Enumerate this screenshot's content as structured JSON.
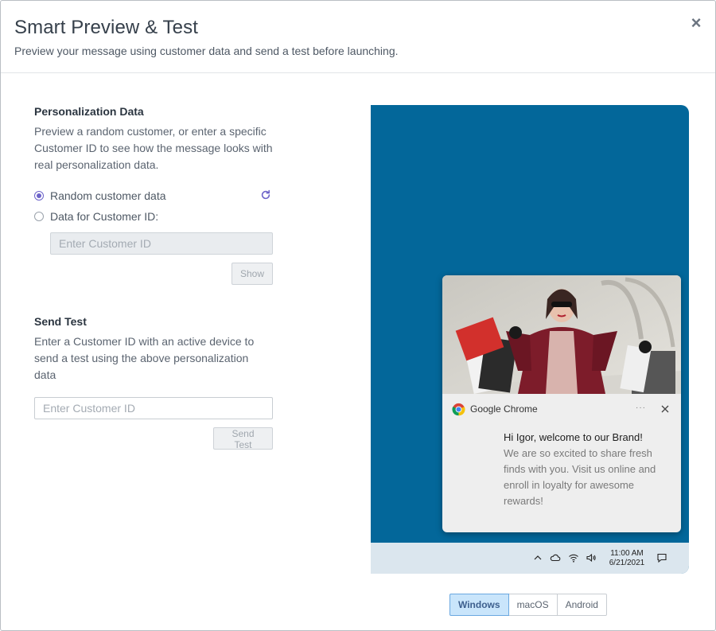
{
  "modal": {
    "title": "Smart Preview & Test",
    "subtitle": "Preview your message using customer data and send a test before launching.",
    "close_label": "×"
  },
  "personalization": {
    "title": "Personalization Data",
    "description": "Preview a random customer, or enter a specific Customer ID to see how the message looks with real personalization data.",
    "options": [
      {
        "label": "Random customer data",
        "checked": true
      },
      {
        "label": "Data for Customer ID:",
        "checked": false
      }
    ],
    "customer_id_placeholder": "Enter Customer ID",
    "customer_id_value": "",
    "show_button": "Show"
  },
  "send_test": {
    "title": "Send Test",
    "description": "Enter a Customer ID with an active device to send a test using the above personalization data",
    "customer_id_placeholder": "Enter Customer ID",
    "customer_id_value": "",
    "send_button": "Send Test"
  },
  "preview": {
    "background_color": "#03679a",
    "notification": {
      "source": "Google Chrome",
      "more_label": "···",
      "title": "Hi Igor, welcome to our Brand!",
      "message": "We are so excited to share fresh finds with you. Visit us online and enroll in loyalty for awesome rewards!"
    },
    "taskbar": {
      "time": "11:00 AM",
      "date": "6/21/2021",
      "icons": [
        "chevron-up-icon",
        "cloud-icon",
        "wifi-icon",
        "volume-icon",
        "notification-center-icon"
      ]
    }
  },
  "platform_tabs": [
    {
      "label": "Windows",
      "active": true
    },
    {
      "label": "macOS",
      "active": false
    },
    {
      "label": "Android",
      "active": false
    }
  ],
  "colors": {
    "accent": "#6c63c9",
    "active_tab_bg": "#c9e5fb"
  }
}
